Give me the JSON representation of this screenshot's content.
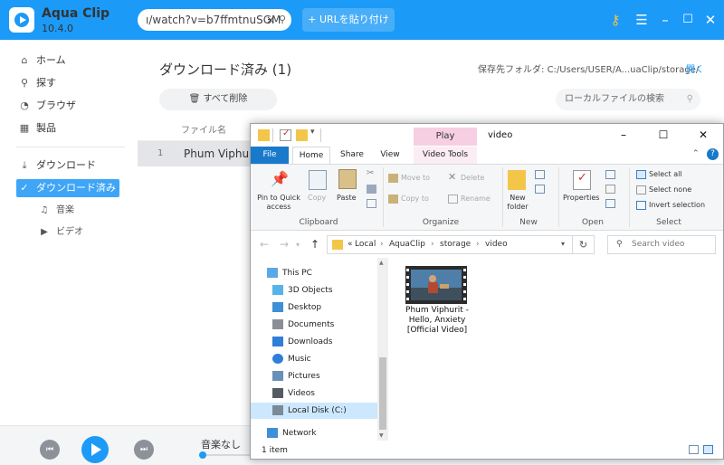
{
  "app": {
    "name": "Aqua Clip",
    "version": "10.4.0",
    "url_value": "ı/watch?v=b7ffmtnuSGM",
    "url_clear": "×",
    "paste_button": "URLを貼り付け",
    "paste_plus": "+",
    "icons": [
      "key-icon",
      "menu-icon",
      "minimize-icon",
      "maximize-icon",
      "close-icon"
    ]
  },
  "sidebar": {
    "items": [
      {
        "label": "ホーム",
        "icon": "⌂"
      },
      {
        "label": "探す",
        "icon": "⚲"
      },
      {
        "label": "ブラウザ",
        "icon": "◔"
      },
      {
        "label": "製品",
        "icon": "▦"
      }
    ],
    "download_items": [
      {
        "label": "ダウンロード",
        "icon": "⤓"
      },
      {
        "label": "ダウンロード済み",
        "icon": "✓"
      }
    ],
    "sub_items": [
      {
        "label": "音楽",
        "icon": "♫"
      },
      {
        "label": "ビデオ",
        "icon": "▶"
      }
    ]
  },
  "main": {
    "title": "ダウンロード済み",
    "count": "(1)",
    "save_folder_label": "保存先フォルダ:",
    "save_folder_path": "C:/Users/USER/A...uaClip/storage/",
    "open_link": "開く",
    "delete_all": "すべて削除",
    "local_search_placeholder": "ローカルファイルの検索",
    "column_name": "ファイル名",
    "rows": [
      {
        "num": "1",
        "name": "Phum Viphurit"
      }
    ]
  },
  "player": {
    "no_music": "音楽なし"
  },
  "explorer": {
    "title": "video",
    "context_tab": "Play",
    "tabs": {
      "file": "File",
      "home": "Home",
      "share": "Share",
      "view": "View",
      "video_tools": "Video Tools"
    },
    "ribbon": {
      "pin": "Pin to Quick access",
      "copy": "Copy",
      "paste": "Paste",
      "clipboard": "Clipboard",
      "move_to": "Move to",
      "copy_to": "Copy to",
      "delete": "Delete",
      "rename": "Rename",
      "organize": "Organize",
      "new_folder": "New folder",
      "new": "New",
      "properties": "Properties",
      "open": "Open",
      "select_all": "Select all",
      "select_none": "Select none",
      "invert_selection": "Invert selection",
      "select": "Select"
    },
    "breadcrumb": [
      "Local",
      "AquaClip",
      "storage",
      "video"
    ],
    "breadcrumb_prefix": "«",
    "search_placeholder": "Search video",
    "nav_items": [
      {
        "label": "This PC",
        "icon": "pc-icon",
        "color": "#5aa9e6"
      },
      {
        "label": "3D Objects",
        "icon": "cube-icon",
        "color": "#56b4e9"
      },
      {
        "label": "Desktop",
        "icon": "desktop-icon",
        "color": "#3d8fd6"
      },
      {
        "label": "Documents",
        "icon": "documents-icon",
        "color": "#8a8f97"
      },
      {
        "label": "Downloads",
        "icon": "downloads-icon",
        "color": "#2f7ed8"
      },
      {
        "label": "Music",
        "icon": "music-icon",
        "color": "#2f7ed8"
      },
      {
        "label": "Pictures",
        "icon": "pictures-icon",
        "color": "#6a8fb8"
      },
      {
        "label": "Videos",
        "icon": "videos-icon",
        "color": "#555b63"
      },
      {
        "label": "Local Disk (C:)",
        "icon": "disk-icon",
        "color": "#7a8a99"
      },
      {
        "label": "Network",
        "icon": "network-icon",
        "color": "#3d8fd6"
      }
    ],
    "file": {
      "name": "Phum Viphurit - Hello, Anxiety [Official Video]"
    },
    "status": "1 item"
  }
}
